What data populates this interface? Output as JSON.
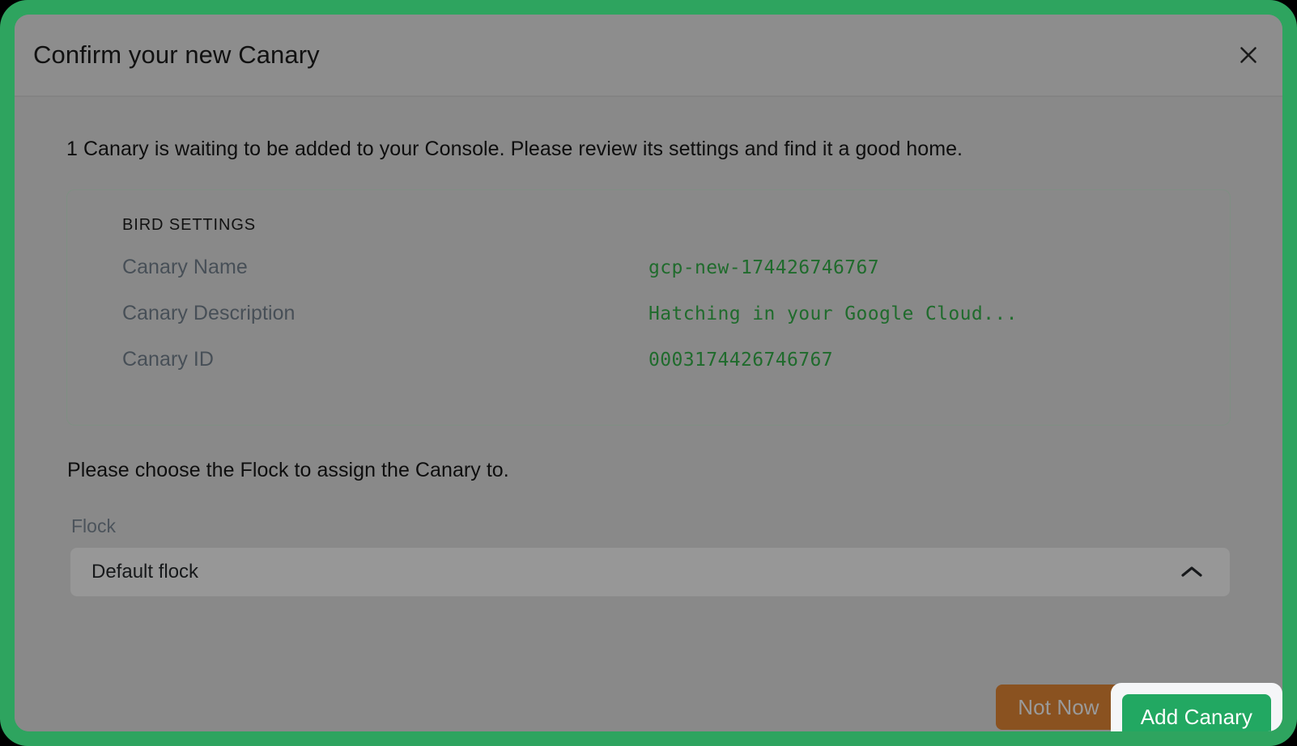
{
  "colors": {
    "frame_green": "#2ea45f",
    "dialog_bg": "#8b8b8b",
    "header_bg": "#8d8d8d",
    "value_green": "#1f6b2c",
    "primary_button_green": "#22a862",
    "secondary_button_brown": "#8a5220",
    "focus_ring_white": "#f5f6f8",
    "card_border": "#7f8f83"
  },
  "header": {
    "title": "Confirm your new Canary",
    "close_icon": "close-icon"
  },
  "body": {
    "intro_text": "1 Canary is waiting to be added to your Console. Please review its settings and find it a good home.",
    "flock_prompt": "Please choose the Flock to assign the Canary to."
  },
  "bird_settings": {
    "heading": "BIRD SETTINGS",
    "rows": [
      {
        "label": "Canary Name",
        "value": "gcp-new-174426746767"
      },
      {
        "label": "Canary Description",
        "value": "Hatching in your Google Cloud..."
      },
      {
        "label": "Canary ID",
        "value": "0003174426746767"
      }
    ]
  },
  "flock": {
    "label": "Flock",
    "selected": "Default flock",
    "chevron_icon": "chevron-up-icon"
  },
  "footer": {
    "secondary_label": "Not Now",
    "primary_label": "Add Canary"
  }
}
